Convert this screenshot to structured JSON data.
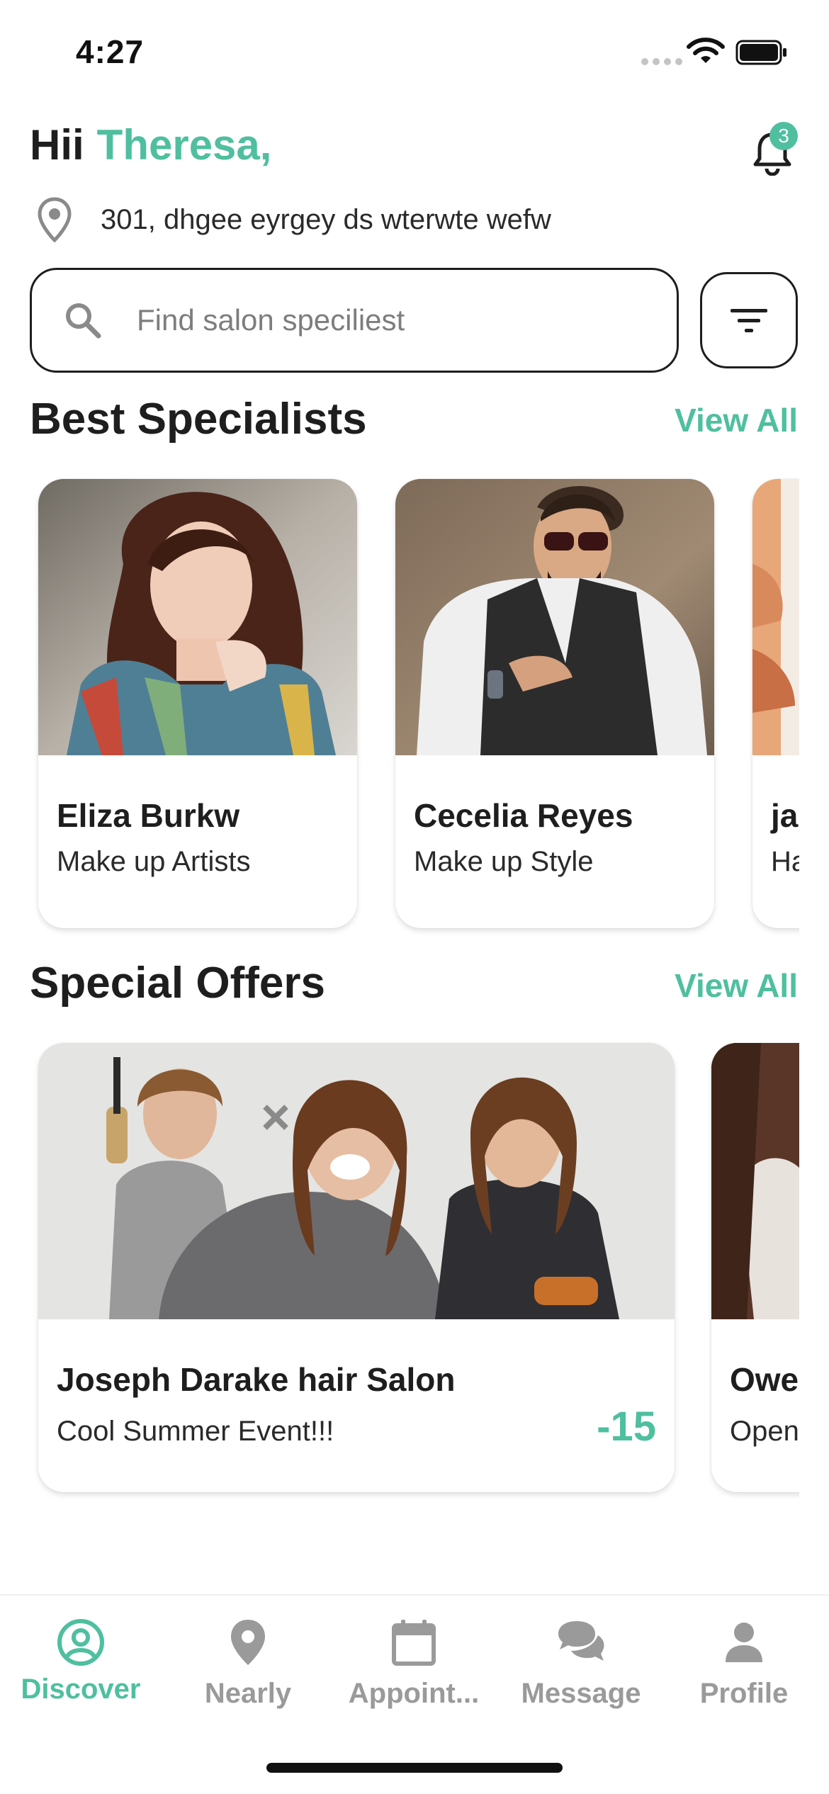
{
  "status_bar": {
    "time": "4:27"
  },
  "header": {
    "greeting": "Hii",
    "user_name": "Theresa,",
    "notification_count": "3",
    "location": "301, dhgee eyrgey ds wterwte wefw"
  },
  "search": {
    "placeholder": "Find salon speciliest"
  },
  "specialists": {
    "title": "Best Specialists",
    "view_all": "View All",
    "items": [
      {
        "name": "Eliza Burkw",
        "role": "Make up Artists"
      },
      {
        "name": "Cecelia Reyes",
        "role": "Make up Style"
      },
      {
        "name": "ja",
        "role": "Ha"
      }
    ]
  },
  "offers": {
    "title": "Special Offers",
    "view_all": "View All",
    "items": [
      {
        "name": "Joseph Darake hair Salon",
        "subtitle": "Cool Summer Event!!!",
        "discount": "-15"
      },
      {
        "name": "Owe",
        "subtitle": "Open"
      }
    ]
  },
  "bottom_nav": {
    "items": [
      {
        "label": "Discover",
        "icon": "user-circle-icon",
        "active": true
      },
      {
        "label": "Nearly",
        "icon": "map-pin-icon",
        "active": false
      },
      {
        "label": "Appoint...",
        "icon": "calendar-icon",
        "active": false
      },
      {
        "label": "Message",
        "icon": "chat-bubbles-icon",
        "active": false
      },
      {
        "label": "Profile",
        "icon": "person-icon",
        "active": false
      }
    ]
  },
  "colors": {
    "accent": "#4fbf9f",
    "text": "#1e1e1e",
    "inactive": "#9a9a9a"
  }
}
